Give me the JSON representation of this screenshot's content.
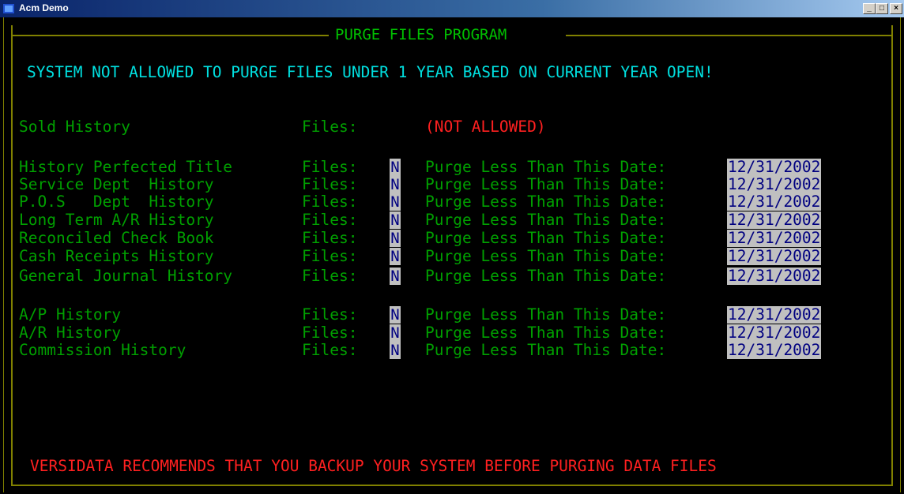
{
  "window": {
    "title": "Acm Demo",
    "minimize": "_",
    "maximize": "□",
    "close": "×"
  },
  "program_title": "PURGE FILES PROGRAM",
  "warning": "SYSTEM NOT ALLOWED TO PURGE FILES UNDER 1 YEAR BASED ON CURRENT YEAR OPEN!",
  "sold_history": {
    "label": "Sold History",
    "files_label": "Files:",
    "status": "(NOT ALLOWED)"
  },
  "purge_label": "Purge Less Than This Date:",
  "files_label": "Files:",
  "rows": [
    {
      "label": "History Perfected Title",
      "flag": "N",
      "date": "12/31/2002"
    },
    {
      "label": "Service Dept  History",
      "flag": "N",
      "date": "12/31/2002"
    },
    {
      "label": "P.O.S   Dept  History",
      "flag": "N",
      "date": "12/31/2002"
    },
    {
      "label": "Long Term A/R History",
      "flag": "N",
      "date": "12/31/2002"
    },
    {
      "label": "Reconciled Check Book",
      "flag": "N",
      "date": "12/31/2002"
    },
    {
      "label": "Cash Receipts History",
      "flag": "N",
      "date": "12/31/2002"
    },
    {
      "label": "General Journal History",
      "flag": "N",
      "date": "12/31/2002"
    }
  ],
  "rows2": [
    {
      "label": "A/P History",
      "flag": "N",
      "date": "12/31/2002"
    },
    {
      "label": "A/R History",
      "flag": "N",
      "date": "12/31/2002"
    },
    {
      "label": "Commission History",
      "flag": "N",
      "date": "12/31/2002"
    }
  ],
  "footer": "VERSIDATA RECOMMENDS THAT YOU BACKUP YOUR SYSTEM BEFORE PURGING DATA FILES",
  "colors": {
    "text_green": "#00a000",
    "text_cyan": "#00e0e0",
    "text_red": "#ff2020",
    "frame_olive": "#808000",
    "field_bg": "#c0c0c0",
    "field_fg": "#000080"
  }
}
